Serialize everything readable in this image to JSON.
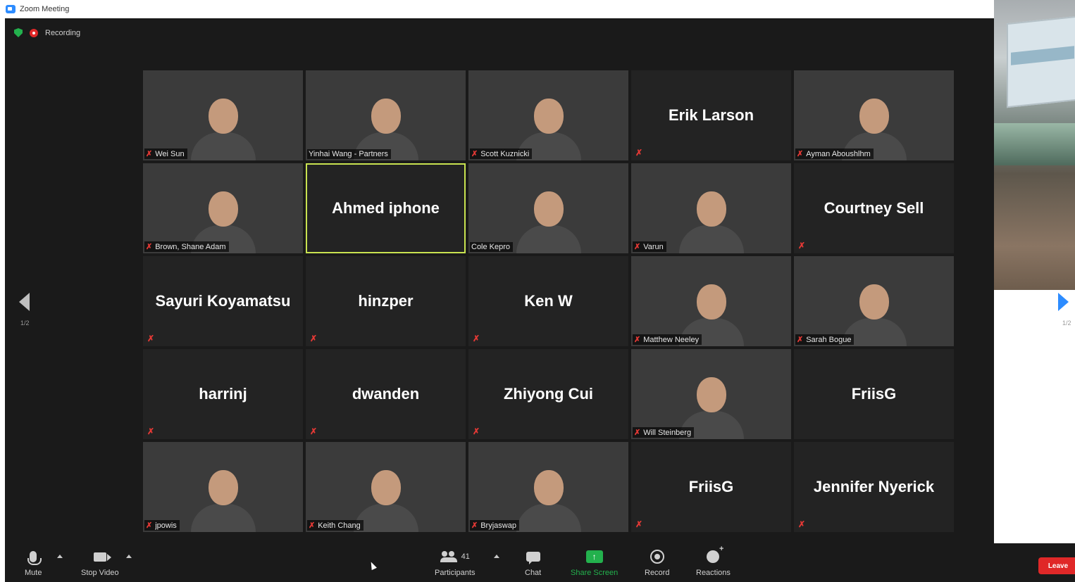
{
  "window": {
    "title": "Zoom Meeting"
  },
  "status": {
    "recording_label": "Recording"
  },
  "tiles": [
    {
      "name": "Wei Sun",
      "display_name": "",
      "type": "video",
      "bg": "bg-purple",
      "muted": true
    },
    {
      "name": "Yinhai Wang - Partners",
      "display_name": "",
      "type": "video",
      "bg": "bg-trees",
      "muted": false
    },
    {
      "name": "Scott Kuznicki",
      "display_name": "",
      "type": "video",
      "bg": "bg-road",
      "muted": true
    },
    {
      "name": "",
      "display_name": "Erik Larson",
      "type": "name",
      "bg": "",
      "muted": true
    },
    {
      "name": "Ayman Aboushlhm",
      "display_name": "",
      "type": "video",
      "bg": "bg-room",
      "muted": true
    },
    {
      "name": "Brown, Shane Adam",
      "display_name": "",
      "type": "video",
      "bg": "bg-plant",
      "muted": true
    },
    {
      "name": "",
      "display_name": "Ahmed iphone",
      "type": "name",
      "bg": "",
      "muted": false,
      "active": true
    },
    {
      "name": "Cole Kepro",
      "display_name": "",
      "type": "video",
      "bg": "bg-sky",
      "muted": false
    },
    {
      "name": "Varun",
      "display_name": "",
      "type": "video",
      "bg": "bg-forest",
      "muted": true
    },
    {
      "name": "",
      "display_name": "Courtney Sell",
      "type": "name",
      "bg": "",
      "muted": true
    },
    {
      "name": "",
      "display_name": "Sayuri Koyamatsu",
      "type": "name",
      "bg": "",
      "muted": true
    },
    {
      "name": "",
      "display_name": "hinzper",
      "type": "name",
      "bg": "",
      "muted": true
    },
    {
      "name": "",
      "display_name": "Ken W",
      "type": "name",
      "bg": "",
      "muted": true
    },
    {
      "name": "Matthew Neeley",
      "display_name": "",
      "type": "video",
      "bg": "bg-warm",
      "muted": true
    },
    {
      "name": "Sarah Bogue",
      "display_name": "",
      "type": "video",
      "bg": "bg-office",
      "muted": true
    },
    {
      "name": "",
      "display_name": "harrinj",
      "type": "name",
      "bg": "",
      "muted": true
    },
    {
      "name": "",
      "display_name": "dwanden",
      "type": "name",
      "bg": "",
      "muted": true
    },
    {
      "name": "",
      "display_name": "Zhiyong Cui",
      "type": "name",
      "bg": "",
      "muted": true
    },
    {
      "name": "Will Steinberg",
      "display_name": "",
      "type": "video",
      "bg": "bg-night",
      "muted": true
    },
    {
      "name": "",
      "display_name": "FriisG",
      "type": "name",
      "bg": "",
      "muted": false
    },
    {
      "name": "jpowis",
      "display_name": "",
      "type": "video",
      "bg": "bg-wall",
      "muted": true
    },
    {
      "name": "Keith Chang",
      "display_name": "",
      "type": "video",
      "bg": "bg-hills",
      "muted": true
    },
    {
      "name": "Bryjaswap",
      "display_name": "",
      "type": "video",
      "bg": "bg-books",
      "muted": true
    },
    {
      "name": "",
      "display_name": "FriisG",
      "type": "name",
      "bg": "",
      "muted": true
    },
    {
      "name": "",
      "display_name": "Jennifer Nyerick",
      "type": "name",
      "bg": "",
      "muted": true
    }
  ],
  "pager": {
    "left": "1/2",
    "right": "1/2"
  },
  "toolbar": {
    "mute": "Mute",
    "stop_video": "Stop Video",
    "participants": "Participants",
    "participants_count": "41",
    "chat": "Chat",
    "share_screen": "Share Screen",
    "record": "Record",
    "reactions": "Reactions",
    "leave": "Leave"
  },
  "colors": {
    "accent": "#2d8cff",
    "share_green": "#23b14d",
    "leave_red": "#e02828",
    "active_speaker": "#c9e350"
  }
}
